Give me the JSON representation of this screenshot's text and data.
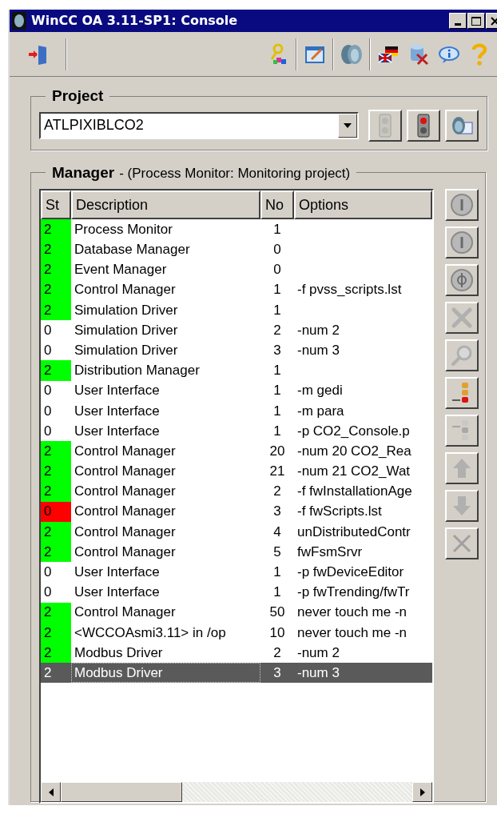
{
  "window": {
    "title": "WinCC OA 3.11-SP1: Console"
  },
  "project": {
    "label": "Project",
    "value": "ATLPIXIBLCO2"
  },
  "manager": {
    "label": "Manager",
    "subtitle": "- (Process Monitor: Monitoring project)",
    "table": {
      "columns": [
        "St",
        "Description",
        "No",
        "Options"
      ],
      "rows": [
        {
          "st": "2",
          "color": "#00ff00",
          "description": "Process Monitor",
          "no": "1",
          "options": "",
          "selected": false
        },
        {
          "st": "2",
          "color": "#00ff00",
          "description": "Database Manager",
          "no": "0",
          "options": "",
          "selected": false
        },
        {
          "st": "2",
          "color": "#00ff00",
          "description": "Event Manager",
          "no": "0",
          "options": "",
          "selected": false
        },
        {
          "st": "2",
          "color": "#00ff00",
          "description": "Control Manager",
          "no": "1",
          "options": "-f pvss_scripts.lst",
          "selected": false
        },
        {
          "st": "2",
          "color": "#00ff00",
          "description": "Simulation Driver",
          "no": "1",
          "options": "",
          "selected": false
        },
        {
          "st": "0",
          "description": "Simulation Driver",
          "no": "2",
          "options": "-num 2",
          "selected": false
        },
        {
          "st": "0",
          "description": "Simulation Driver",
          "no": "3",
          "options": "-num 3",
          "selected": false
        },
        {
          "st": "2",
          "color": "#00ff00",
          "description": "Distribution Manager",
          "no": "1",
          "options": "",
          "selected": false
        },
        {
          "st": "0",
          "description": "User Interface",
          "no": "1",
          "options": "-m gedi",
          "selected": false
        },
        {
          "st": "0",
          "description": "User Interface",
          "no": "1",
          "options": "-m para",
          "selected": false
        },
        {
          "st": "0",
          "description": "User Interface",
          "no": "1",
          "options": "-p CO2_Console.p",
          "selected": false
        },
        {
          "st": "2",
          "color": "#00ff00",
          "description": "Control Manager",
          "no": "20",
          "options": "-num 20 CO2_Rea",
          "selected": false
        },
        {
          "st": "2",
          "color": "#00ff00",
          "description": "Control Manager",
          "no": "21",
          "options": "-num 21 CO2_Wat",
          "selected": false
        },
        {
          "st": "2",
          "color": "#00ff00",
          "description": "Control Manager",
          "no": "2",
          "options": "-f fwInstallationAge",
          "selected": false
        },
        {
          "st": "0",
          "color": "#ff0000",
          "description": "Control Manager",
          "no": "3",
          "options": "-f fwScripts.lst",
          "selected": false
        },
        {
          "st": "2",
          "color": "#00ff00",
          "description": "Control Manager",
          "no": "4",
          "options": "unDistributedContr",
          "selected": false
        },
        {
          "st": "2",
          "color": "#00ff00",
          "description": "Control Manager",
          "no": "5",
          "options": "fwFsmSrvr",
          "selected": false
        },
        {
          "st": "0",
          "description": "User Interface",
          "no": "1",
          "options": "-p fwDeviceEditor",
          "selected": false
        },
        {
          "st": "0",
          "description": "User Interface",
          "no": "1",
          "options": "-p fwTrending/fwTr",
          "selected": false
        },
        {
          "st": "2",
          "color": "#00ff00",
          "description": "Control Manager",
          "no": "50",
          "options": "never touch me -n",
          "selected": false
        },
        {
          "st": "2",
          "color": "#00ff00",
          "description": "<WCCOAsmi3.11> in /op",
          "no": "10",
          "options": "never touch me -n",
          "selected": false
        },
        {
          "st": "2",
          "color": "#00ff00",
          "description": "Modbus Driver",
          "no": "2",
          "options": "-num 2",
          "selected": false
        },
        {
          "st": "2",
          "description": "Modbus Driver",
          "no": "3",
          "options": "-num 3",
          "selected": true
        }
      ]
    }
  }
}
